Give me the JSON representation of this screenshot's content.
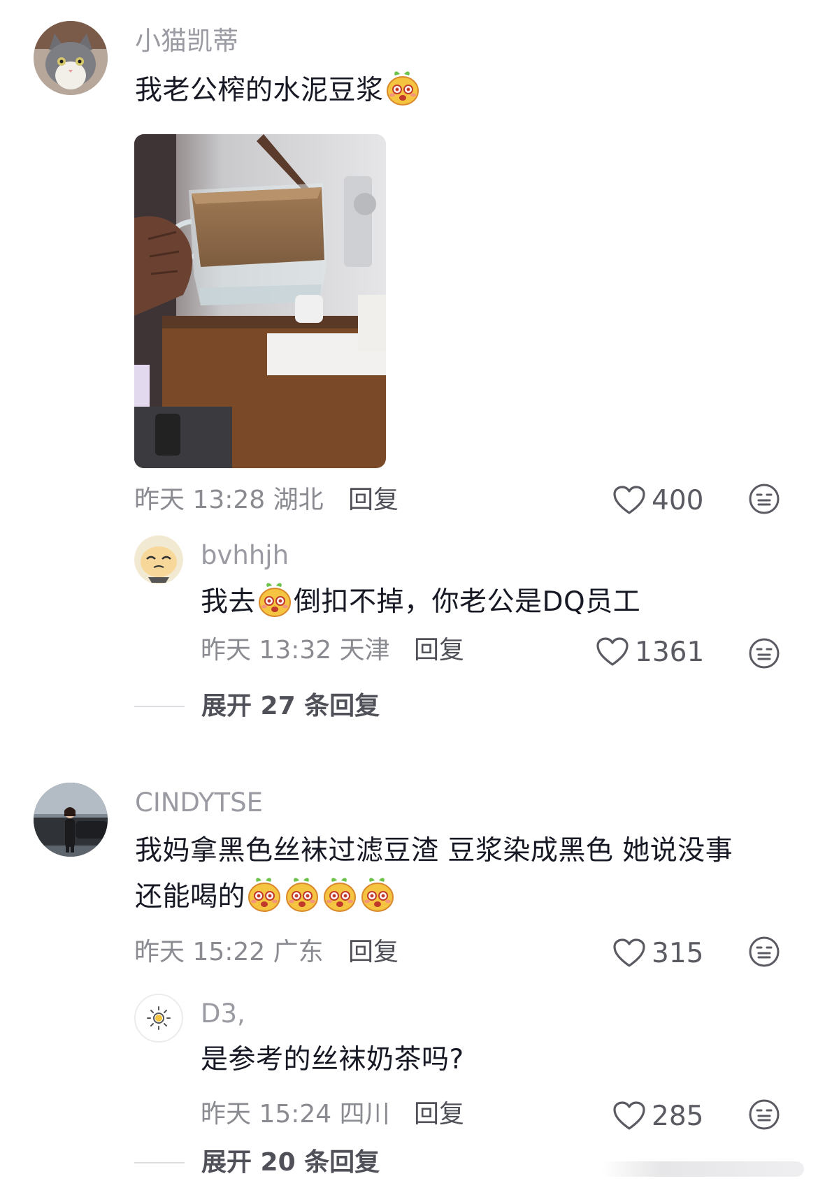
{
  "comments": [
    {
      "username": "小猫凯蒂",
      "text": "我老公榨的水泥豆浆",
      "emojis": [
        "cute-face-emoji"
      ],
      "timestamp": "昨天 13:28",
      "location": "湖北",
      "reply_label": "回复",
      "likes": "400",
      "reply": {
        "username": "bvhhjh",
        "text_before": "我去",
        "text_after": "倒扣不掉，你老公是DQ员工",
        "timestamp": "昨天 13:32",
        "location": "天津",
        "reply_label": "回复",
        "likes": "1361"
      },
      "expand_label": "展开 27 条回复"
    },
    {
      "username": "CINDYTSE",
      "text_line1": "我妈拿黑色丝袜过滤豆渣 豆浆染成黑色 她说没事",
      "text_line2": "还能喝的",
      "timestamp": "昨天 15:22",
      "location": "广东",
      "reply_label": "回复",
      "likes": "315",
      "reply": {
        "username": "D3,",
        "text": "是参考的丝袜奶茶吗?",
        "timestamp": "昨天 15:24",
        "location": "四川",
        "reply_label": "回复",
        "likes": "285"
      },
      "expand_label": "展开 20 条回复"
    }
  ],
  "icons": {
    "like": "heart-outline-icon",
    "dislike": "neutral-face-icon",
    "emoji": "cute-face-emoji"
  },
  "colors": {
    "text": "#161823",
    "secondary": "#9a9ba2",
    "meta": "#8a8b91"
  }
}
